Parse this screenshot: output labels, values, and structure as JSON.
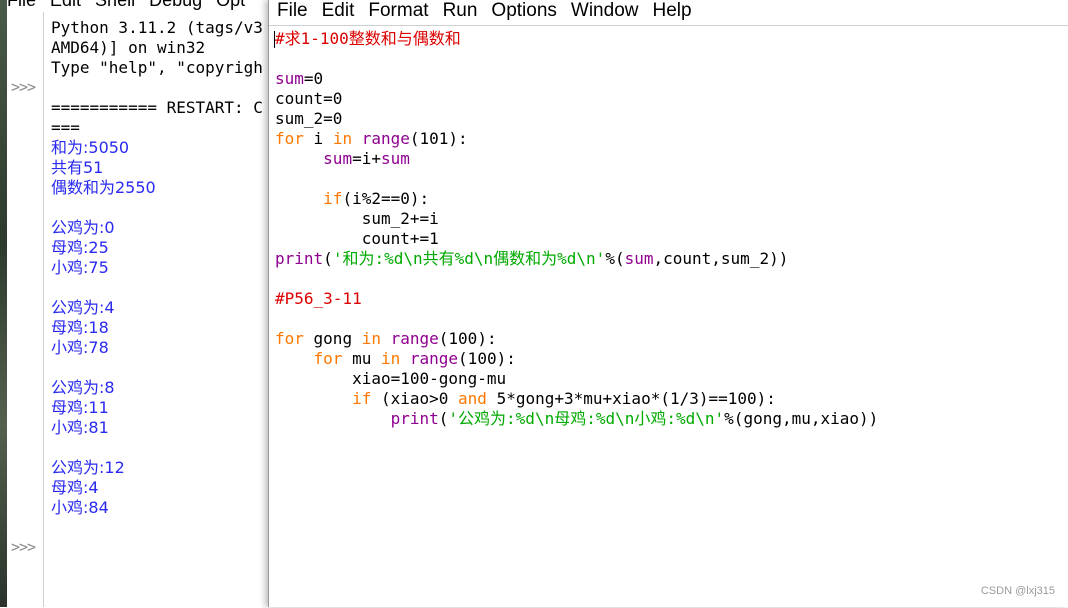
{
  "shell": {
    "menu": [
      "File",
      "Edit",
      "Shell",
      "Debug",
      "Opt"
    ],
    "prompt": ">>>",
    "header_lines": [
      "Python 3.11.2 (tags/v3",
      "AMD64)] on win32",
      "Type \"help\", \"copyrigh",
      "",
      "=========== RESTART: C",
      "==="
    ],
    "output_lines": [
      "和为:5050",
      "共有51",
      "偶数和为2550",
      "",
      "公鸡为:0",
      "母鸡:25",
      "小鸡:75",
      "",
      "公鸡为:4",
      "母鸡:18",
      "小鸡:78",
      "",
      "公鸡为:8",
      "母鸡:11",
      "小鸡:81",
      "",
      "公鸡为:12",
      "母鸡:4",
      "小鸡:84"
    ]
  },
  "editor": {
    "menu": [
      "File",
      "Edit",
      "Format",
      "Run",
      "Options",
      "Window",
      "Help"
    ],
    "code_lines": [
      [
        {
          "t": "#求1-100整数和与偶数和",
          "c": "cmt"
        }
      ],
      [],
      [
        {
          "t": "sum",
          "c": "bi"
        },
        {
          "t": "=0"
        }
      ],
      [
        {
          "t": "count=0"
        }
      ],
      [
        {
          "t": "sum_2=0"
        }
      ],
      [
        {
          "t": "for",
          "c": "kw"
        },
        {
          "t": " i "
        },
        {
          "t": "in",
          "c": "kw"
        },
        {
          "t": " "
        },
        {
          "t": "range",
          "c": "bi"
        },
        {
          "t": "(101):"
        }
      ],
      [
        {
          "t": "     "
        },
        {
          "t": "sum",
          "c": "bi"
        },
        {
          "t": "=i+"
        },
        {
          "t": "sum",
          "c": "bi"
        }
      ],
      [],
      [
        {
          "t": "     "
        },
        {
          "t": "if",
          "c": "kw"
        },
        {
          "t": "(i%2==0):"
        }
      ],
      [
        {
          "t": "         sum_2+=i"
        }
      ],
      [
        {
          "t": "         count+=1"
        }
      ],
      [
        {
          "t": "print",
          "c": "bi"
        },
        {
          "t": "("
        },
        {
          "t": "'和为:%d\\n共有%d\\n偶数和为%d\\n'",
          "c": "str"
        },
        {
          "t": "%("
        },
        {
          "t": "sum",
          "c": "bi"
        },
        {
          "t": ",count,sum_2))"
        }
      ],
      [],
      [
        {
          "t": "#P56_3-11",
          "c": "cmt"
        }
      ],
      [],
      [
        {
          "t": "for",
          "c": "kw"
        },
        {
          "t": " gong "
        },
        {
          "t": "in",
          "c": "kw"
        },
        {
          "t": " "
        },
        {
          "t": "range",
          "c": "bi"
        },
        {
          "t": "(100):"
        }
      ],
      [
        {
          "t": "    "
        },
        {
          "t": "for",
          "c": "kw"
        },
        {
          "t": " mu "
        },
        {
          "t": "in",
          "c": "kw"
        },
        {
          "t": " "
        },
        {
          "t": "range",
          "c": "bi"
        },
        {
          "t": "(100):"
        }
      ],
      [
        {
          "t": "        xiao=100-gong-mu"
        }
      ],
      [
        {
          "t": "        "
        },
        {
          "t": "if",
          "c": "kw"
        },
        {
          "t": " (xiao>0 "
        },
        {
          "t": "and",
          "c": "kw"
        },
        {
          "t": " 5*gong+3*mu+xiao*(1/3)==100):"
        }
      ],
      [
        {
          "t": "            "
        },
        {
          "t": "print",
          "c": "bi"
        },
        {
          "t": "("
        },
        {
          "t": "'公鸡为:%d\\n母鸡:%d\\n小鸡:%d\\n'",
          "c": "str"
        },
        {
          "t": "%(gong,mu,xiao))"
        }
      ]
    ]
  },
  "watermark": "CSDN @lxj315"
}
